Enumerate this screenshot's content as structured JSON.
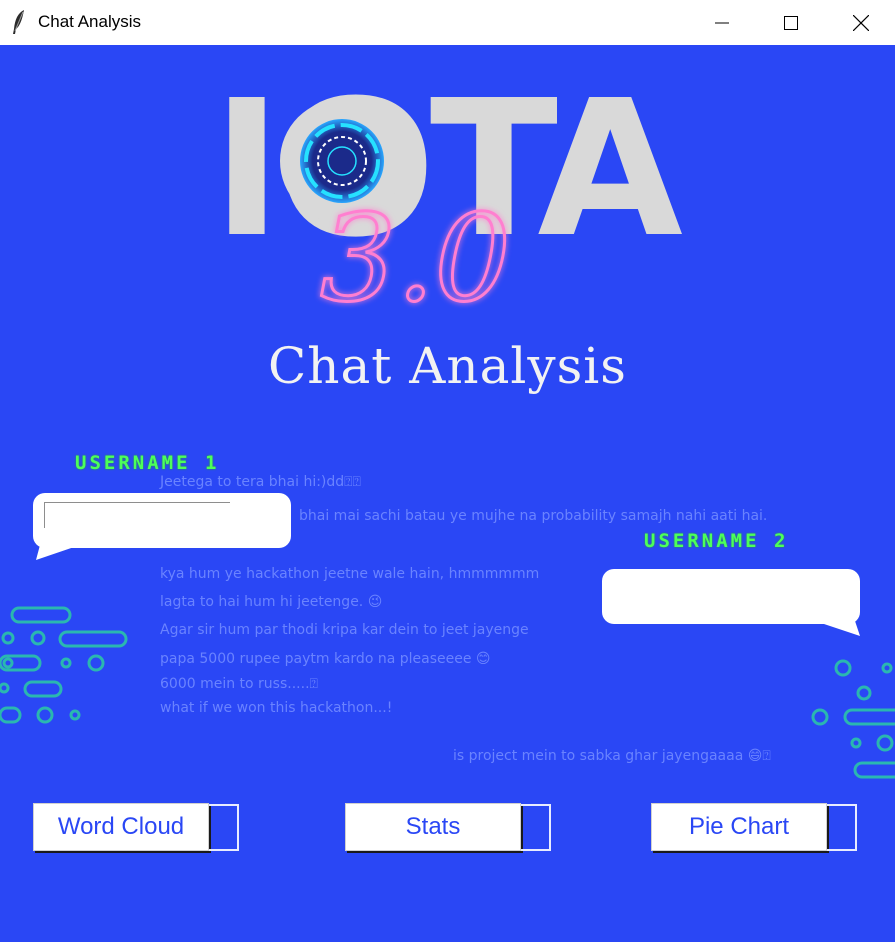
{
  "window": {
    "title": "Chat Analysis",
    "controls": {
      "minimize": "minimize-icon",
      "maximize": "maximize-icon",
      "close": "close-icon"
    }
  },
  "banner": {
    "logo_text": "IOTA",
    "logo_script": "3.0",
    "heading": "Chat Analysis"
  },
  "users": {
    "user1_label": "USERNAME 1",
    "user2_label": "USERNAME 2",
    "user1_value": "",
    "user2_value": ""
  },
  "chat_lines": [
    "Jeetega to tera bhai hi:)dd⍰⍰",
    "bhai mai sachi batau ye mujhe na probability samajh nahi aati hai.",
    "kya hum ye hackathon jeetne wale hain, hmmmmmm",
    "lagta to hai hum hi jeetenge. 😉",
    "Agar sir hum par thodi kripa kar dein to jeet jayenge",
    "papa 5000 rupee paytm kardo na pleaseeee 😊",
    "6000 mein to russ.....⍰",
    "what if we won this hackathon...!",
    "is project mein to sabka ghar jayengaaaa 😄⍰"
  ],
  "buttons": {
    "word_cloud": "Word Cloud",
    "stats": "Stats",
    "pie_chart": "Pie Chart"
  },
  "colors": {
    "background": "#2a47f5",
    "username_label": "#4cff5a",
    "button_text": "#2a47f5",
    "logo_text": "#d9d9d9",
    "neon_script": "#ff7fd0"
  }
}
